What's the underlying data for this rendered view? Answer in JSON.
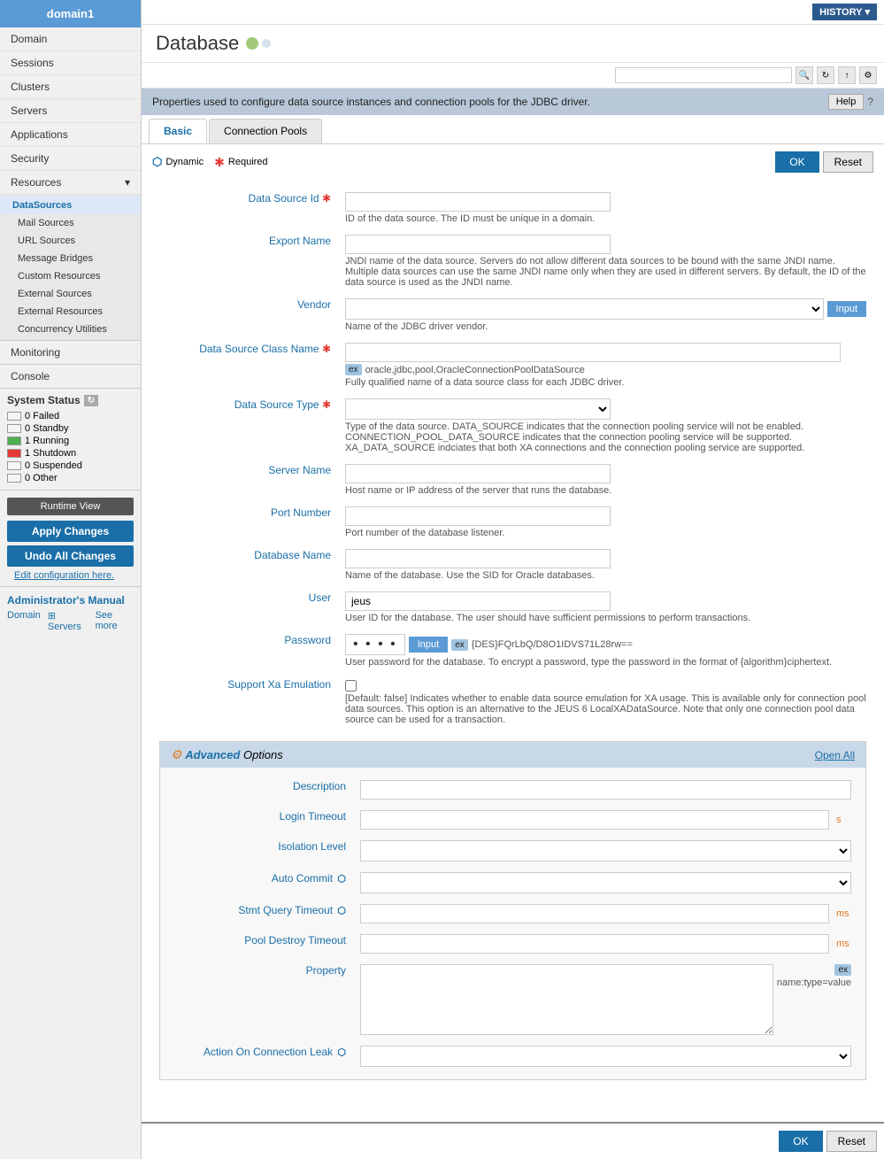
{
  "sidebar": {
    "domain_title": "domain1",
    "nav_items": [
      {
        "label": "Domain",
        "id": "domain"
      },
      {
        "label": "Sessions",
        "id": "sessions"
      },
      {
        "label": "Clusters",
        "id": "clusters"
      },
      {
        "label": "Servers",
        "id": "servers"
      },
      {
        "label": "Applications",
        "id": "applications"
      },
      {
        "label": "Security",
        "id": "security"
      },
      {
        "label": "Resources",
        "id": "resources",
        "arrow": true
      }
    ],
    "resources_items": [
      {
        "label": "DataSources",
        "id": "datasources",
        "active": true
      },
      {
        "label": "Mail Sources",
        "id": "mail-sources"
      },
      {
        "label": "URL Sources",
        "id": "url-sources"
      },
      {
        "label": "Message Bridges",
        "id": "message-bridges"
      },
      {
        "label": "Custom Resources",
        "id": "custom-resources"
      },
      {
        "label": "External Sources",
        "id": "external-sources"
      },
      {
        "label": "External Resources",
        "id": "external-resources"
      },
      {
        "label": "Concurrency Utilities",
        "id": "concurrency-utilities"
      }
    ],
    "monitoring": "Monitoring",
    "console": "Console",
    "system_status_title": "System Status",
    "status_items": [
      {
        "label": "0 Failed",
        "type": "empty"
      },
      {
        "label": "0 Standby",
        "type": "empty"
      },
      {
        "label": "1 Running",
        "type": "running"
      },
      {
        "label": "1 Shutdown",
        "type": "shutdown"
      },
      {
        "label": "0 Suspended",
        "type": "empty"
      },
      {
        "label": "0 Other",
        "type": "empty"
      }
    ],
    "runtime_view_btn": "Runtime View",
    "apply_changes_btn": "Apply Changes",
    "undo_changes_btn": "Undo All Changes",
    "edit_config_link": "Edit configuration here.",
    "admin_manual_title": "Administrator's Manual",
    "admin_manual_domain": "Domain",
    "admin_manual_servers": "Servers",
    "admin_manual_see_more": "See more"
  },
  "topbar": {
    "history_btn": "HISTORY",
    "search_placeholder": ""
  },
  "page": {
    "title": "Database",
    "info_text": "Properties used to configure data source instances and connection pools for the JDBC driver.",
    "help_btn": "Help",
    "help_icon": "?"
  },
  "tabs": [
    {
      "label": "Basic",
      "id": "basic",
      "active": true
    },
    {
      "label": "Connection Pools",
      "id": "connection-pools",
      "active": false
    }
  ],
  "legend": {
    "dynamic_label": "Dynamic",
    "required_label": "Required"
  },
  "buttons": {
    "ok": "OK",
    "reset": "Reset"
  },
  "form": {
    "data_source_id_label": "Data Source Id",
    "data_source_id_value": "",
    "data_source_id_desc": "ID of the data source. The ID must be unique in a domain.",
    "export_name_label": "Export Name",
    "export_name_value": "",
    "export_name_desc": "JNDI name of the data source. Servers do not allow different data sources to be bound with the same JNDI name. Multiple data sources can use the same JNDI name only when they are used in different servers. By default, the ID of the data source is used as the JNDI name.",
    "vendor_label": "Vendor",
    "vendor_value": "",
    "vendor_desc": "Name of the JDBC driver vendor.",
    "vendor_input_btn": "Input",
    "data_source_class_name_label": "Data Source Class Name",
    "data_source_class_name_value": "",
    "data_source_class_name_example": "oracle,jdbc,pool,OracleConnectionPoolDataSource",
    "data_source_class_name_desc": "Fully qualified name of a data source class for each JDBC driver.",
    "data_source_type_label": "Data Source Type",
    "data_source_type_value": "",
    "data_source_type_desc": "Type of the data source. DATA_SOURCE indicates that the connection pooling service will not be enabled. CONNECTION_POOL_DATA_SOURCE indicates that the connection pooling service will be supported. XA_DATA_SOURCE indciates that both XA connections and the connection pooling service are supported.",
    "server_name_label": "Server Name",
    "server_name_value": "",
    "server_name_desc": "Host name or IP address of the server that runs the database.",
    "port_number_label": "Port Number",
    "port_number_value": "",
    "port_number_desc": "Port number of the database listener.",
    "database_name_label": "Database Name",
    "database_name_value": "",
    "database_name_desc": "Name of the database. Use the SID for Oracle databases.",
    "user_label": "User",
    "user_value": "jeus",
    "user_desc": "User ID for the database. The user should have sufficient permissions to perform transactions.",
    "password_label": "Password",
    "password_value": "• • • •",
    "password_input_btn": "Input",
    "password_example": "{DES}FQrLbQ/D8O1IDVS71L28rw==",
    "password_desc": "User password for the database. To encrypt a password, type the password in the format of {algorithm}ciphertext.",
    "support_xa_label": "Support Xa Emulation",
    "support_xa_desc": "[Default: false]  Indicates whether to enable data source emulation for XA usage. This is available only for connection pool data sources. This option is an alternative to the JEUS 6 LocalXADataSource. Note that only one connection pool data source can be used for a transaction."
  },
  "advanced": {
    "section_title": "Advanced",
    "options_label": "Options",
    "open_all": "Open All",
    "description_label": "Description",
    "description_value": "",
    "login_timeout_label": "Login Timeout",
    "login_timeout_value": "",
    "login_timeout_unit": "s",
    "isolation_level_label": "Isolation Level",
    "isolation_level_value": "",
    "auto_commit_label": "Auto Commit",
    "auto_commit_value": "",
    "stmt_query_timeout_label": "Stmt Query Timeout",
    "stmt_query_timeout_value": "",
    "stmt_query_timeout_unit": "ms",
    "pool_destroy_timeout_label": "Pool Destroy Timeout",
    "pool_destroy_timeout_value": "",
    "pool_destroy_timeout_unit": "ms",
    "property_label": "Property",
    "property_value": "",
    "property_example": "name:type=value",
    "action_on_connection_leak_label": "Action On Connection Leak",
    "action_on_connection_leak_value": ""
  }
}
